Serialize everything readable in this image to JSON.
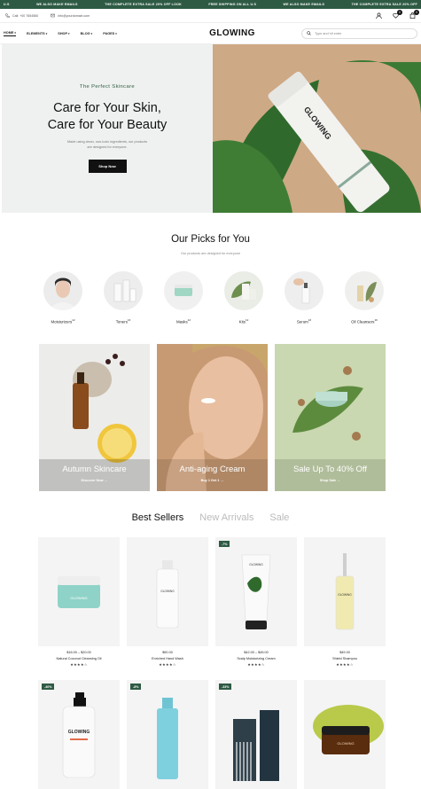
{
  "ticker": [
    "U.S",
    "WE ALSO MAKE EMAILS",
    "THE COMPLETE EXTRA SALE 20% OFF LOOK",
    "FREE SHIPPING ON ALL U.S",
    "WE ALSO MAKE EMAILS",
    "THE COMPLETE EXTRA SALE 20% OFF"
  ],
  "util": {
    "phone": "Call: +00 7654560",
    "email": "info@yourdomain.com",
    "cart_count": "0",
    "wish_count": "0"
  },
  "nav": {
    "items": [
      "HOME",
      "ELEMENTS",
      "SHOP",
      "BLOG",
      "PAGES"
    ],
    "logo": "GLOWING",
    "search_placeholder": "Type and hit enter"
  },
  "hero": {
    "subtitle": "The Perfect Skincare",
    "title_line1": "Care for Your Skin,",
    "title_line2": "Care for Your Beauty",
    "desc": "Made using clean, non-toxic ingredients, our products are designed for everyone.",
    "button": "Shop Now",
    "tube_text": "GLOWING"
  },
  "picks": {
    "title": "Our Picks for You",
    "subtitle": "Our products are designed for everyone",
    "categories": [
      {
        "label": "Moisturizers",
        "count": "12"
      },
      {
        "label": "Toners",
        "count": "16"
      },
      {
        "label": "Masks",
        "count": "12"
      },
      {
        "label": "Kits",
        "count": "12"
      },
      {
        "label": "Serum",
        "count": "16"
      },
      {
        "label": "Oil Cleansers",
        "count": "16"
      }
    ]
  },
  "banners": [
    {
      "title": "Autumn Skincare",
      "link": "Discover Now →"
    },
    {
      "title": "Anti-aging Cream",
      "link": "Buy 1 Get 1 →"
    },
    {
      "title": "Sale Up To 40% Off",
      "link": "Shop Sale →"
    }
  ],
  "tabs": {
    "active": "Best Sellers",
    "t2": "New Arrivals",
    "t3": "Sale"
  },
  "products_row1": [
    {
      "badge": "",
      "price": "$16.00 – $20.00",
      "name": "Natural Coconut Cleansing Oil",
      "stars": "★★★★☆"
    },
    {
      "badge": "",
      "price": "$90.00",
      "name": "Enriched Hand Wash",
      "stars": "★★★★☆"
    },
    {
      "badge": "-7%",
      "price": "$42.00 – $45.00",
      "name": "Scalp Moisturizing Cream",
      "stars": "★★★★☆"
    },
    {
      "badge": "",
      "price": "$49.00",
      "name": "Shield Shampoo",
      "stars": "★★★★☆"
    }
  ],
  "products_row2": [
    {
      "badge": "-40%"
    },
    {
      "badge": "-8%"
    },
    {
      "badge": "-33%"
    },
    {
      "badge": ""
    }
  ],
  "product_brand": "GLOWING",
  "colors": {
    "brand_green": "#2e5a43",
    "hero_bg": "#eef1ef",
    "text": "#111111"
  }
}
